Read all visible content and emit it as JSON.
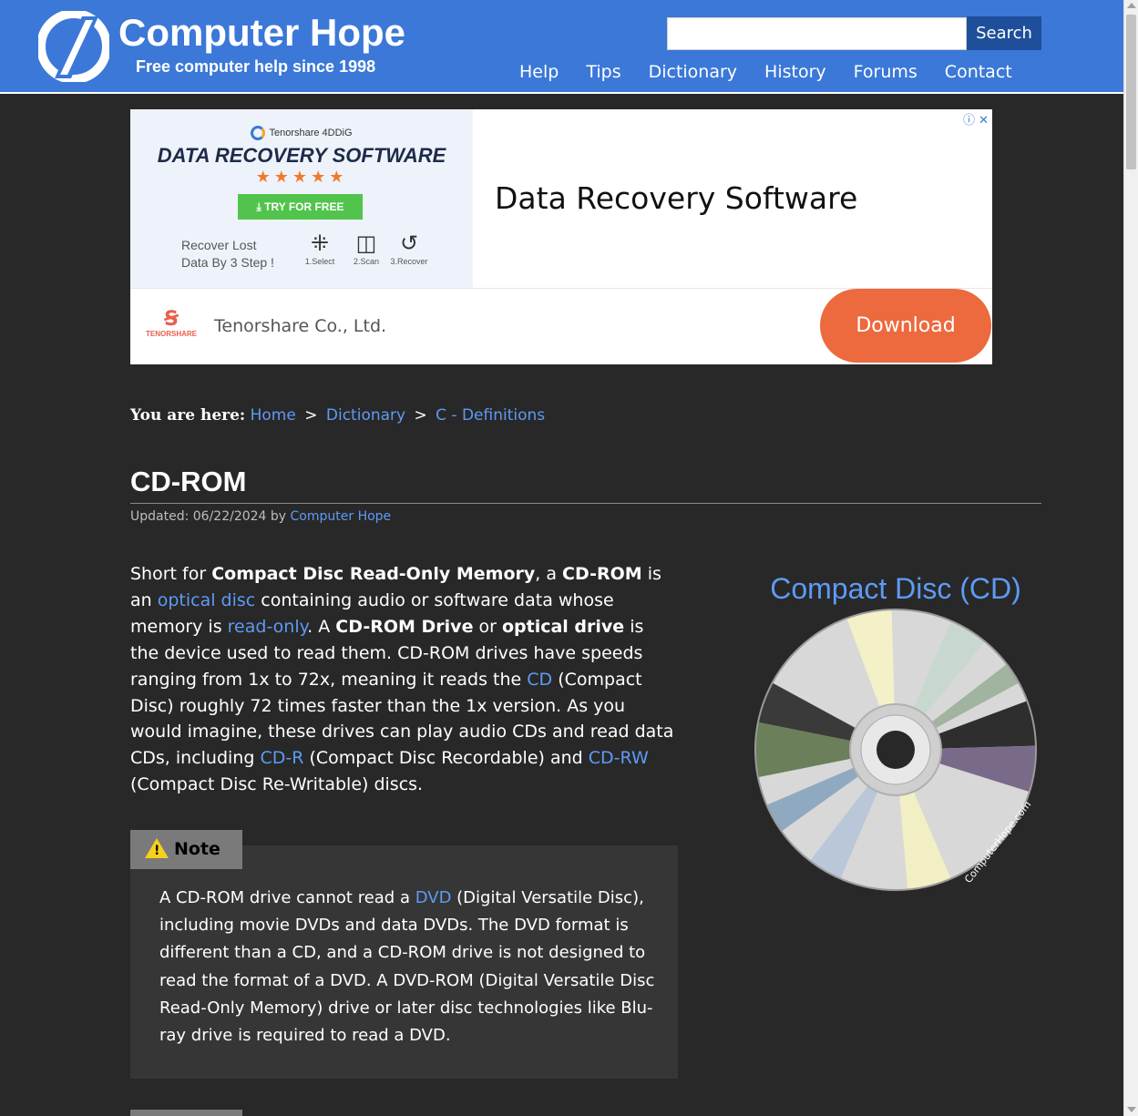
{
  "header": {
    "title": "Computer Hope",
    "tagline": "Free computer help since 1998",
    "search": {
      "placeholder": "",
      "button_label": "Search"
    },
    "nav": [
      "Help",
      "Tips",
      "Dictionary",
      "History",
      "Forums",
      "Contact"
    ]
  },
  "ad": {
    "brand": "Tenorshare 4DDiG",
    "heading": "DATA RECOVERY SOFTWARE",
    "stars": "★★★★★",
    "try_label": "TRY FOR FREE",
    "recover_line1": "Recover Lost",
    "recover_line2": "Data By 3 Step !",
    "steps": [
      "1.Select",
      "2.Scan",
      "3.Recover"
    ],
    "title": "Data Recovery Software",
    "company": "Tenorshare Co., Ltd.",
    "company_logo_text": "TENORSHARE",
    "download_label": "Download",
    "info_close": "ⓘ ✕"
  },
  "breadcrumb": {
    "label": "You are here:",
    "items": [
      "Home",
      "Dictionary",
      "C - Definitions"
    ],
    "separator": ">"
  },
  "page": {
    "title": "CD-ROM",
    "updated_prefix": "Updated: 06/22/2024 by",
    "updated_author": "Computer Hope"
  },
  "intro": {
    "p1": "Short for ",
    "b1": "Compact Disc Read-Only Memory",
    "p2": ", a ",
    "b2": "CD-ROM",
    "p3": " is an ",
    "l1": "optical disc",
    "p4": " containing audio or software data whose memory is ",
    "l2": "read-only",
    "p5": ". A ",
    "b3": "CD-ROM Drive",
    "p6": " or ",
    "b4": "optical drive",
    "p7": " is the device used to read them. CD-ROM drives have speeds ranging from 1x to 72x, meaning it reads the ",
    "l3": "CD",
    "p8": " (Compact Disc) roughly 72 times faster than the 1x version. As you would imagine, these drives can play audio CDs and read data CDs, including ",
    "l4": "CD-R",
    "p9": " (Compact Disc Recordable) and ",
    "l5": "CD-RW",
    "p10": " (Compact Disc Re-Writable) discs."
  },
  "figure": {
    "caption": "Compact Disc (CD)",
    "watermark": "ComputerHope.com"
  },
  "note": {
    "label": "Note",
    "t1": "A CD-ROM drive cannot read a ",
    "link": "DVD",
    "t2": " (Digital Versatile Disc), including movie DVDs and data DVDs. The DVD format is different than a CD, and a CD-ROM drive is not designed to read the format of a DVD. A DVD-ROM (Digital Versatile Disc Read-Only Memory) drive or later disc technologies like Blu-ray drive is required to read a DVD."
  },
  "colors": {
    "header_bg": "#3b78d8",
    "page_bg": "#282828",
    "link": "#5e9af5",
    "search_button": "#1f4f9a",
    "download_button": "#ec6a3d",
    "try_button": "#52c44d"
  }
}
